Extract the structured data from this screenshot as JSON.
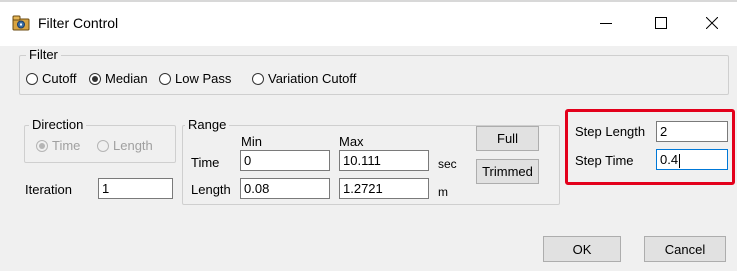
{
  "window": {
    "title": "Filter Control"
  },
  "filter": {
    "legend": "Filter",
    "options": [
      "Cutoff",
      "Median",
      "Low Pass",
      "Variation Cutoff"
    ],
    "selected": "Median"
  },
  "direction": {
    "legend": "Direction",
    "options": [
      "Time",
      "Length"
    ],
    "selected": "Time",
    "enabled": false
  },
  "iteration": {
    "label": "Iteration",
    "value": "1"
  },
  "range": {
    "legend": "Range",
    "min_header": "Min",
    "max_header": "Max",
    "rows": [
      {
        "label": "Time",
        "min": "0",
        "max": "10.111",
        "unit": "sec"
      },
      {
        "label": "Length",
        "min": "0.08",
        "max": "1.2721",
        "unit": "m"
      }
    ],
    "full_label": "Full",
    "trimmed_label": "Trimmed"
  },
  "step": {
    "length_label": "Step Length",
    "length_value": "2",
    "time_label": "Step Time",
    "time_value": "0.4",
    "highlight_color": "#e3001b"
  },
  "buttons": {
    "ok": "OK",
    "cancel": "Cancel"
  },
  "icons": {
    "app": "filter-app-icon",
    "minimize": "minimize-icon",
    "maximize": "maximize-icon",
    "close": "close-icon"
  }
}
